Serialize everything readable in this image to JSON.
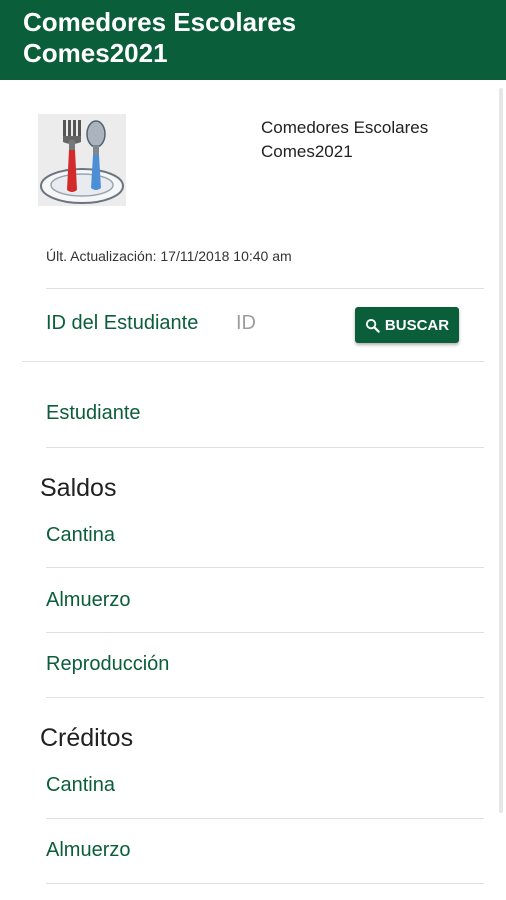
{
  "app_bar": {
    "title": "Comedores Escolares\nComes2021"
  },
  "header": {
    "logo_icon": "fork-spoon-plate-icon",
    "title": "Comedores Escolares\nComes2021",
    "last_updated": "Últ. Actualización: 17/11/2018 10:40 am"
  },
  "search": {
    "label": "ID del Estudiante",
    "placeholder": "ID",
    "value": "",
    "button_label": "BUSCAR",
    "button_icon": "search-icon"
  },
  "student": {
    "label": "Estudiante"
  },
  "saldos": {
    "heading": "Saldos",
    "items": [
      "Cantina",
      "Almuerzo",
      "Reproducción"
    ]
  },
  "creditos": {
    "heading": "Créditos",
    "items": [
      "Cantina",
      "Almuerzo"
    ]
  },
  "colors": {
    "primary": "#0b5e3a",
    "text": "#212121",
    "hint": "#9e9e9e"
  }
}
